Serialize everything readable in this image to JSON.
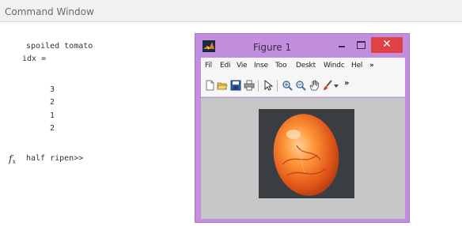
{
  "command_window": {
    "title": "Command Window",
    "output_lines": [
      "spoiled tomato",
      "idx =",
      "3",
      "2",
      "1",
      "2"
    ],
    "prompt_icon": "fx-icon",
    "prompt_line": "half ripen>>"
  },
  "figure": {
    "title": "Figure 1",
    "logo_icon": "matlab-logo-icon",
    "window_buttons": {
      "minimize": "minimize-icon",
      "maximize": "maximize-icon",
      "close": "close-icon"
    },
    "close_glyph": "✕",
    "menus": [
      "Fil",
      "Edi",
      "Vie",
      "Inse",
      "Too",
      "Deskt",
      "Windc",
      "Hel"
    ],
    "menu_overflow": "»",
    "toolbar_icons": [
      "new-figure-icon",
      "open-file-icon",
      "save-icon",
      "print-icon",
      "pointer-icon",
      "zoom-in-icon",
      "zoom-out-icon",
      "pan-icon",
      "brush-icon",
      "dropdown-arrow-icon"
    ],
    "toolbar_overflow": "»",
    "image": "tomato-photo"
  },
  "colors": {
    "figure_border": "#c28fde",
    "close_button": "#e04343",
    "axes_background": "#c7c7c7",
    "command_text": "#333333"
  }
}
